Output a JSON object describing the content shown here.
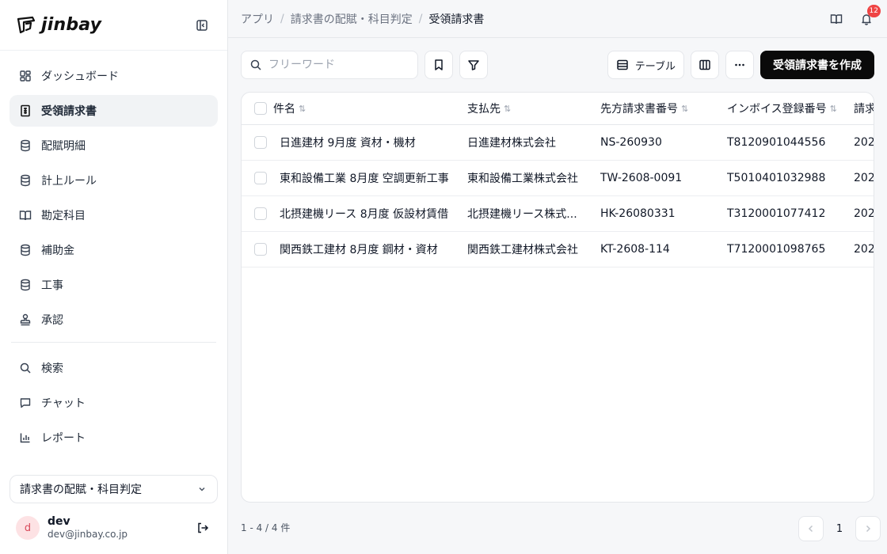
{
  "app": {
    "logo_text": "jinbay"
  },
  "sidebar": {
    "items": [
      {
        "label": "ダッシュボード",
        "icon": "dashboard-icon"
      },
      {
        "label": "受領請求書",
        "icon": "receipt-icon",
        "active": true
      },
      {
        "label": "配賦明細",
        "icon": "database-icon"
      },
      {
        "label": "計上ルール",
        "icon": "database-icon"
      },
      {
        "label": "勘定科目",
        "icon": "book-icon"
      },
      {
        "label": "補助金",
        "icon": "database-icon"
      },
      {
        "label": "工事",
        "icon": "database-icon"
      },
      {
        "label": "承認",
        "icon": "stamp-icon"
      }
    ],
    "secondary_items": [
      {
        "label": "検索",
        "icon": "search-icon"
      },
      {
        "label": "チャット",
        "icon": "chat-icon"
      },
      {
        "label": "レポート",
        "icon": "bar-chart-icon"
      }
    ],
    "project_select": "請求書の配賦・科目判定",
    "user": {
      "initial": "d",
      "name": "dev",
      "email": "dev@jinbay.co.jp"
    }
  },
  "header": {
    "breadcrumb": [
      "アプリ",
      "請求書の配賦・科目判定",
      "受領請求書"
    ],
    "notification_count": "12"
  },
  "toolbar": {
    "search_placeholder": "フリーワード",
    "view_label": "テーブル",
    "create_label": "受領請求書を作成"
  },
  "table": {
    "columns": [
      "件名",
      "支払先",
      "先方請求書番号",
      "インボイス登録番号",
      "請求"
    ],
    "rows": [
      {
        "subject": "日進建材 9月度 資材・機材",
        "payee": "日進建材株式会社",
        "number": "NS-260930",
        "invoice": "T8120901044556",
        "date": "202"
      },
      {
        "subject": "東和設備工業 8月度 空調更新工事",
        "payee": "東和設備工業株式会社",
        "number": "TW-2608-0091",
        "invoice": "T5010401032988",
        "date": "202"
      },
      {
        "subject": "北摂建機リース 8月度 仮設材賃借",
        "payee": "北摂建機リース株式...",
        "number": "HK-26080331",
        "invoice": "T3120001077412",
        "date": "202"
      },
      {
        "subject": "関西鉄工建材 8月度 鋼材・資材",
        "payee": "関西鉄工建材株式会社",
        "number": "KT-2608-114",
        "invoice": "T7120001098765",
        "date": "202"
      }
    ]
  },
  "footer": {
    "count": "1 - 4 / 4 件",
    "page": "1"
  },
  "colors": {
    "accent": "#0a0a0a",
    "badge": "#ef4444",
    "avatar_bg": "#fde2e4"
  }
}
